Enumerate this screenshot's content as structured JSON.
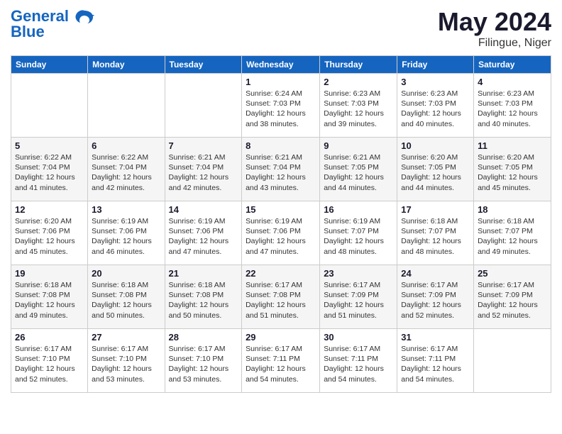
{
  "header": {
    "logo_line1": "General",
    "logo_line2": "Blue",
    "month_year": "May 2024",
    "location": "Filingue, Niger"
  },
  "weekdays": [
    "Sunday",
    "Monday",
    "Tuesday",
    "Wednesday",
    "Thursday",
    "Friday",
    "Saturday"
  ],
  "weeks": [
    [
      {
        "day": "",
        "info": ""
      },
      {
        "day": "",
        "info": ""
      },
      {
        "day": "",
        "info": ""
      },
      {
        "day": "1",
        "info": "Sunrise: 6:24 AM\nSunset: 7:03 PM\nDaylight: 12 hours\nand 38 minutes."
      },
      {
        "day": "2",
        "info": "Sunrise: 6:23 AM\nSunset: 7:03 PM\nDaylight: 12 hours\nand 39 minutes."
      },
      {
        "day": "3",
        "info": "Sunrise: 6:23 AM\nSunset: 7:03 PM\nDaylight: 12 hours\nand 40 minutes."
      },
      {
        "day": "4",
        "info": "Sunrise: 6:23 AM\nSunset: 7:03 PM\nDaylight: 12 hours\nand 40 minutes."
      }
    ],
    [
      {
        "day": "5",
        "info": "Sunrise: 6:22 AM\nSunset: 7:04 PM\nDaylight: 12 hours\nand 41 minutes."
      },
      {
        "day": "6",
        "info": "Sunrise: 6:22 AM\nSunset: 7:04 PM\nDaylight: 12 hours\nand 42 minutes."
      },
      {
        "day": "7",
        "info": "Sunrise: 6:21 AM\nSunset: 7:04 PM\nDaylight: 12 hours\nand 42 minutes."
      },
      {
        "day": "8",
        "info": "Sunrise: 6:21 AM\nSunset: 7:04 PM\nDaylight: 12 hours\nand 43 minutes."
      },
      {
        "day": "9",
        "info": "Sunrise: 6:21 AM\nSunset: 7:05 PM\nDaylight: 12 hours\nand 44 minutes."
      },
      {
        "day": "10",
        "info": "Sunrise: 6:20 AM\nSunset: 7:05 PM\nDaylight: 12 hours\nand 44 minutes."
      },
      {
        "day": "11",
        "info": "Sunrise: 6:20 AM\nSunset: 7:05 PM\nDaylight: 12 hours\nand 45 minutes."
      }
    ],
    [
      {
        "day": "12",
        "info": "Sunrise: 6:20 AM\nSunset: 7:06 PM\nDaylight: 12 hours\nand 45 minutes."
      },
      {
        "day": "13",
        "info": "Sunrise: 6:19 AM\nSunset: 7:06 PM\nDaylight: 12 hours\nand 46 minutes."
      },
      {
        "day": "14",
        "info": "Sunrise: 6:19 AM\nSunset: 7:06 PM\nDaylight: 12 hours\nand 47 minutes."
      },
      {
        "day": "15",
        "info": "Sunrise: 6:19 AM\nSunset: 7:06 PM\nDaylight: 12 hours\nand 47 minutes."
      },
      {
        "day": "16",
        "info": "Sunrise: 6:19 AM\nSunset: 7:07 PM\nDaylight: 12 hours\nand 48 minutes."
      },
      {
        "day": "17",
        "info": "Sunrise: 6:18 AM\nSunset: 7:07 PM\nDaylight: 12 hours\nand 48 minutes."
      },
      {
        "day": "18",
        "info": "Sunrise: 6:18 AM\nSunset: 7:07 PM\nDaylight: 12 hours\nand 49 minutes."
      }
    ],
    [
      {
        "day": "19",
        "info": "Sunrise: 6:18 AM\nSunset: 7:08 PM\nDaylight: 12 hours\nand 49 minutes."
      },
      {
        "day": "20",
        "info": "Sunrise: 6:18 AM\nSunset: 7:08 PM\nDaylight: 12 hours\nand 50 minutes."
      },
      {
        "day": "21",
        "info": "Sunrise: 6:18 AM\nSunset: 7:08 PM\nDaylight: 12 hours\nand 50 minutes."
      },
      {
        "day": "22",
        "info": "Sunrise: 6:17 AM\nSunset: 7:08 PM\nDaylight: 12 hours\nand 51 minutes."
      },
      {
        "day": "23",
        "info": "Sunrise: 6:17 AM\nSunset: 7:09 PM\nDaylight: 12 hours\nand 51 minutes."
      },
      {
        "day": "24",
        "info": "Sunrise: 6:17 AM\nSunset: 7:09 PM\nDaylight: 12 hours\nand 52 minutes."
      },
      {
        "day": "25",
        "info": "Sunrise: 6:17 AM\nSunset: 7:09 PM\nDaylight: 12 hours\nand 52 minutes."
      }
    ],
    [
      {
        "day": "26",
        "info": "Sunrise: 6:17 AM\nSunset: 7:10 PM\nDaylight: 12 hours\nand 52 minutes."
      },
      {
        "day": "27",
        "info": "Sunrise: 6:17 AM\nSunset: 7:10 PM\nDaylight: 12 hours\nand 53 minutes."
      },
      {
        "day": "28",
        "info": "Sunrise: 6:17 AM\nSunset: 7:10 PM\nDaylight: 12 hours\nand 53 minutes."
      },
      {
        "day": "29",
        "info": "Sunrise: 6:17 AM\nSunset: 7:11 PM\nDaylight: 12 hours\nand 54 minutes."
      },
      {
        "day": "30",
        "info": "Sunrise: 6:17 AM\nSunset: 7:11 PM\nDaylight: 12 hours\nand 54 minutes."
      },
      {
        "day": "31",
        "info": "Sunrise: 6:17 AM\nSunset: 7:11 PM\nDaylight: 12 hours\nand 54 minutes."
      },
      {
        "day": "",
        "info": ""
      }
    ]
  ]
}
